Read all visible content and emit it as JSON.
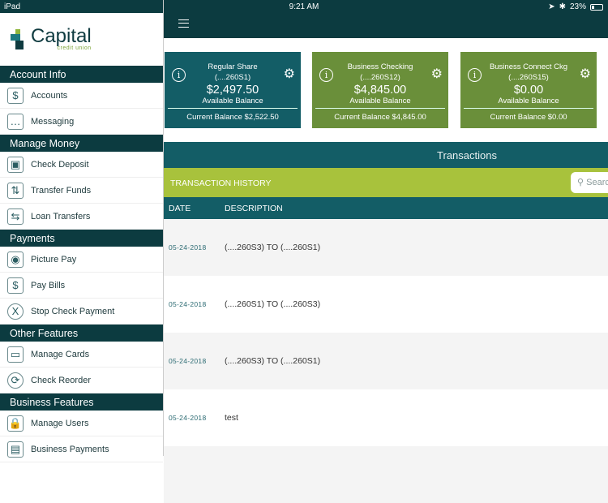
{
  "status": {
    "device": "iPad",
    "time": "9:21 AM",
    "battery": "23%"
  },
  "logo": {
    "name": "Capital",
    "sub": "credit union"
  },
  "sidebar": [
    {
      "section": "Account Info",
      "items": [
        {
          "label": "Accounts",
          "icon": "coins-icon"
        },
        {
          "label": "Messaging",
          "icon": "laptop-chat-icon"
        }
      ]
    },
    {
      "section": "Manage Money",
      "items": [
        {
          "label": "Check Deposit",
          "icon": "safe-icon"
        },
        {
          "label": "Transfer Funds",
          "icon": "transfer-icon"
        },
        {
          "label": "Loan Transfers",
          "icon": "loan-icon"
        }
      ]
    },
    {
      "section": "Payments",
      "items": [
        {
          "label": "Picture Pay",
          "icon": "camera-icon"
        },
        {
          "label": "Pay Bills",
          "icon": "bill-icon"
        },
        {
          "label": "Stop Check Payment",
          "icon": "x-circle-icon"
        }
      ]
    },
    {
      "section": "Other Features",
      "items": [
        {
          "label": "Manage Cards",
          "icon": "card-icon"
        },
        {
          "label": "Check Reorder",
          "icon": "reorder-icon"
        }
      ]
    },
    {
      "section": "Business Features",
      "items": [
        {
          "label": "Manage Users",
          "icon": "lock-icon"
        },
        {
          "label": "Business Payments",
          "icon": "briefcase-icon"
        }
      ]
    }
  ],
  "cards": [
    {
      "name": "Regular Share",
      "number": "(....260S1)",
      "balance": "$2,497.50",
      "balance_label": "Available Balance",
      "current": "Current Balance $2,522.50",
      "color": "#135d66"
    },
    {
      "name": "Business Checking",
      "number": "(....260S12)",
      "balance": "$4,845.00",
      "balance_label": "Available Balance",
      "current": "Current Balance $4,845.00",
      "color": "#6a8f3a"
    },
    {
      "name": "Business Connect Ckg",
      "number": "(....260S15)",
      "balance": "$0.00",
      "balance_label": "Available Balance",
      "current": "Current Balance $0.00",
      "color": "#6a8f3a"
    }
  ],
  "transactions": {
    "title": "Transactions",
    "history_label": "TRANSACTION HISTORY",
    "search_placeholder": "Search",
    "columns": [
      "DATE",
      "DESCRIPTION"
    ],
    "rows": [
      {
        "date": "05-24-2018",
        "description": "(....260S3) TO (....260S1)"
      },
      {
        "date": "05-24-2018",
        "description": "(....260S1) TO (....260S3)"
      },
      {
        "date": "05-24-2018",
        "description": "(....260S3) TO (....260S1)"
      },
      {
        "date": "05-24-2018",
        "description": "test"
      }
    ]
  }
}
